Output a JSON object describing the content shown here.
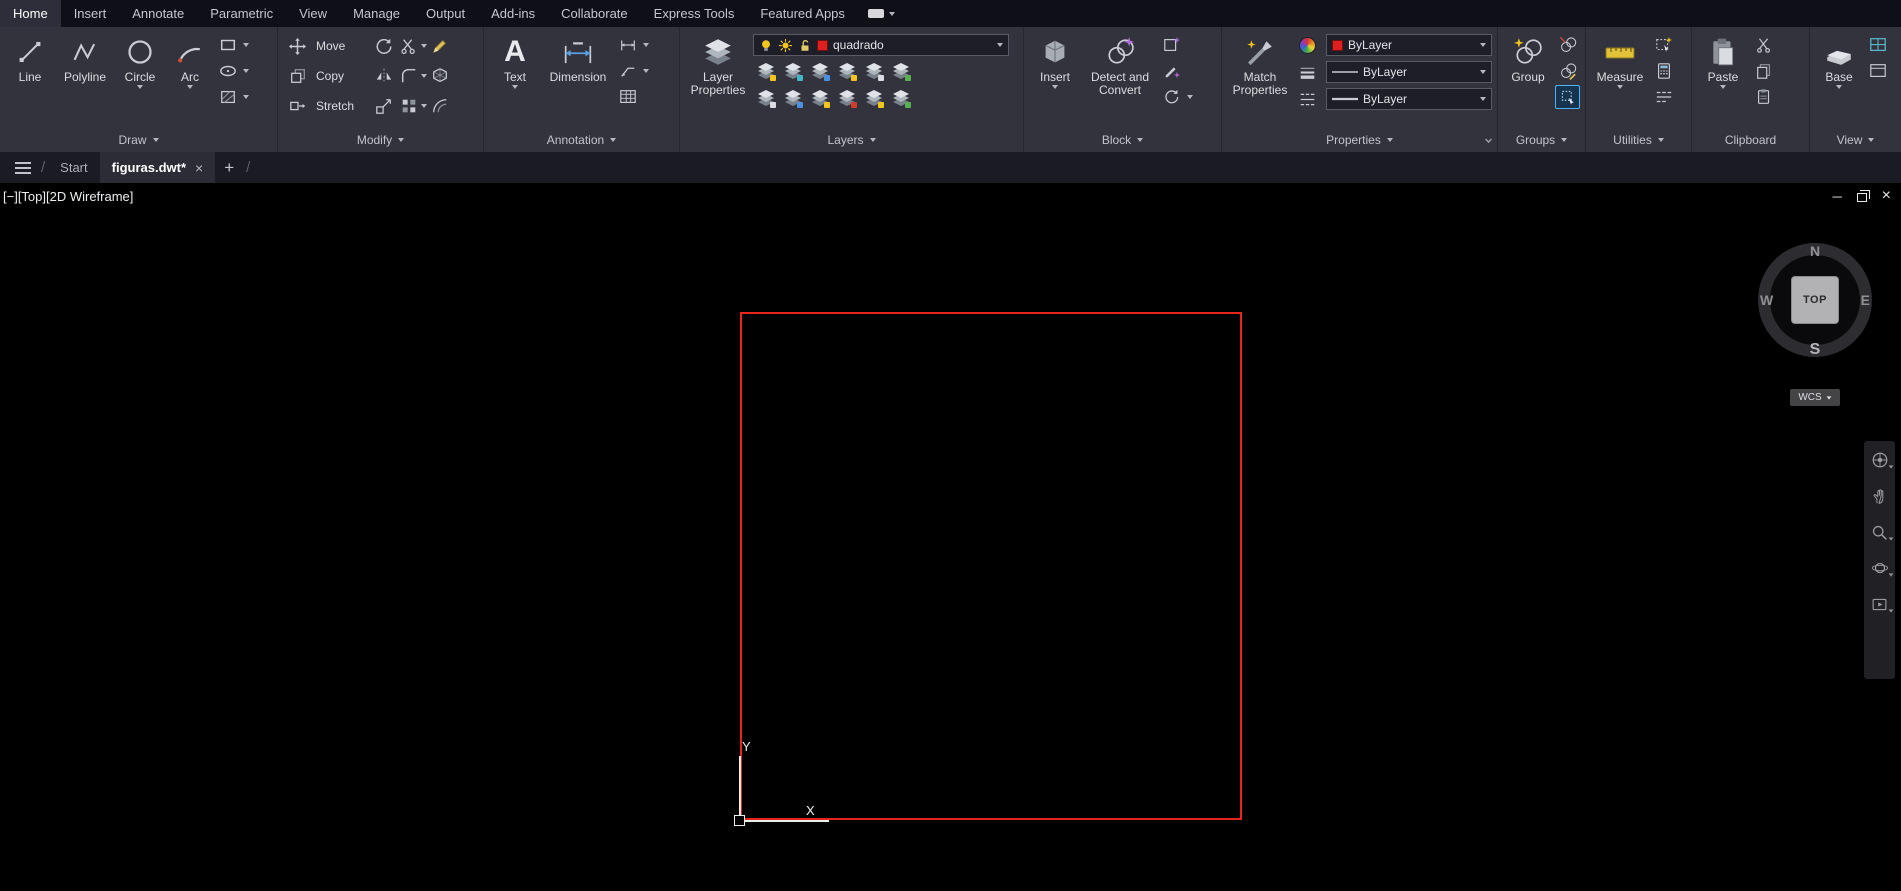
{
  "menubar": {
    "tabs": [
      "Home",
      "Insert",
      "Annotate",
      "Parametric",
      "View",
      "Manage",
      "Output",
      "Add-ins",
      "Collaborate",
      "Express Tools",
      "Featured Apps"
    ]
  },
  "ribbon": {
    "draw": {
      "label": "Draw",
      "line": "Line",
      "polyline": "Polyline",
      "circle": "Circle",
      "arc": "Arc"
    },
    "modify": {
      "label": "Modify",
      "move": "Move",
      "copy": "Copy",
      "stretch": "Stretch"
    },
    "annotation": {
      "label": "Annotation",
      "text": "Text",
      "dimension": "Dimension",
      "text_glyph": "A"
    },
    "layers": {
      "label": "Layers",
      "layer_properties": "Layer Properties",
      "current_layer": "quadrado"
    },
    "block": {
      "label": "Block",
      "insert": "Insert",
      "detect_convert": "Detect and Convert"
    },
    "properties": {
      "label": "Properties",
      "match_properties": "Match Properties",
      "color_value": "ByLayer",
      "linetype_value": "ByLayer",
      "lineweight_value": "ByLayer"
    },
    "groups": {
      "label": "Groups",
      "group": "Group"
    },
    "utilities": {
      "label": "Utilities",
      "measure": "Measure"
    },
    "clipboard": {
      "label": "Clipboard",
      "paste": "Paste"
    },
    "view": {
      "label": "View",
      "base": "Base"
    }
  },
  "tabbar": {
    "start_tab": "Start",
    "active_tab": "figuras.dwt*",
    "close": "×",
    "new_tab": "+",
    "separator": "/"
  },
  "viewport": {
    "controls_label": "[−][Top][2D Wireframe]",
    "window_buttons": {
      "minimize": "─",
      "close": "×"
    },
    "viewcube": {
      "north": "N",
      "south": "S",
      "east": "E",
      "west": "W",
      "face": "TOP"
    },
    "wcs_label": "WCS",
    "ucs": {
      "x_label": "X",
      "y_label": "Y"
    },
    "square_color": "#e8251d"
  },
  "colors": {
    "current_layer_swatch": "#e02020",
    "bylayer_swatch": "#e02020",
    "layer_status_yellow": "#f2c51e"
  }
}
